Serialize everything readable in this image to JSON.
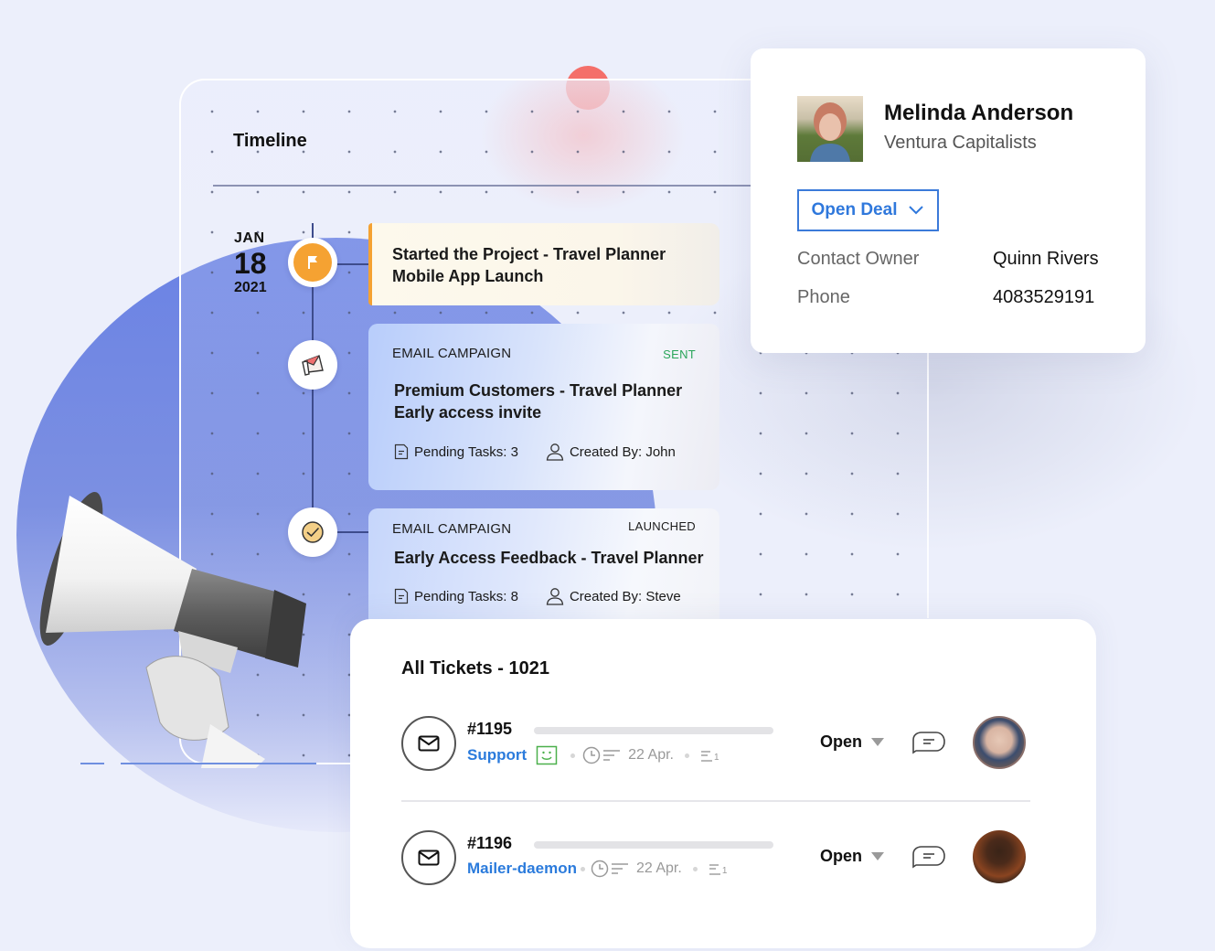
{
  "timeline": {
    "title": "Timeline",
    "date": {
      "month": "JAN",
      "day": "18",
      "year": "2021"
    },
    "events": [
      {
        "icon": "flag-icon",
        "title_line1": "Started the Project - Travel Planner",
        "title_line2": "Mobile App Launch"
      },
      {
        "icon": "megaphone-mail-icon",
        "kind": "EMAIL CAMPAIGN",
        "status": "SENT",
        "title_line1": "Premium Customers - Travel Planner",
        "title_line2": "Early access invite",
        "pending_tasks": "Pending Tasks: 3",
        "created_by": "Created By: John"
      },
      {
        "icon": "check-clock-icon",
        "kind": "EMAIL CAMPAIGN",
        "status": "LAUNCHED",
        "title_line1": "Early Access Feedback - Travel Planner",
        "pending_tasks": "Pending Tasks: 8",
        "created_by": "Created By: Steve"
      }
    ]
  },
  "contact": {
    "name": "Melinda Anderson",
    "company": "Ventura Capitalists",
    "open_deal_label": "Open Deal",
    "fields": [
      {
        "label": "Contact Owner",
        "value": "Quinn Rivers"
      },
      {
        "label": "Phone",
        "value": "4083529191"
      }
    ]
  },
  "tickets": {
    "title": "All Tickets - 1021",
    "rows": [
      {
        "id": "#1195",
        "department": "Support",
        "date": "22 Apr.",
        "thread_count": "1",
        "status": "Open",
        "has_smiley": true
      },
      {
        "id": "#1196",
        "department": "Mailer-daemon",
        "date": "22 Apr.",
        "thread_count": "1",
        "status": "Open",
        "has_smiley": false
      }
    ]
  },
  "colors": {
    "accent_blue": "#2f78dc",
    "flag_orange": "#f5a232",
    "sent_green": "#2aa55a",
    "timeline_line": "#3e4c8c",
    "blob_blue": "#6a82e4"
  }
}
